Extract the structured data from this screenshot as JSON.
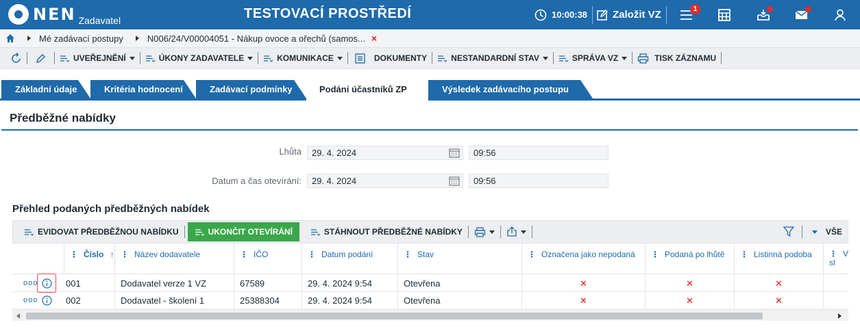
{
  "header": {
    "logo_text": "NEN",
    "logo_sub": "Zadavatel",
    "environment_title": "TESTOVACÍ PROSTŘEDÍ",
    "clock_time": "10:00:38",
    "create_label": "Založit VZ",
    "notifications_count": "1",
    "icons": [
      "clock-icon",
      "edit-icon",
      "menu-icon",
      "calculator-icon",
      "inbox-icon",
      "mail-icon",
      "user-icon"
    ],
    "colors": {
      "primary": "#1e6aab",
      "alert": "#e52b2b"
    }
  },
  "breadcrumb": {
    "items": [
      "Mé zadávací postupy",
      "N006/24/V00004051 - Nákup ovoce a ořechů (samos..."
    ],
    "close_symbol": "×"
  },
  "actionbar": {
    "items": [
      {
        "label": "UVEŘEJNĚNÍ",
        "dropdown": true
      },
      {
        "label": "ÚKONY ZADAVATELE",
        "dropdown": true
      },
      {
        "label": "KOMUNIKACE",
        "dropdown": true
      },
      {
        "label": "DOKUMENTY",
        "dropdown": false
      },
      {
        "label": "NESTANDARDNÍ STAV",
        "dropdown": true
      },
      {
        "label": "SPRÁVA VZ",
        "dropdown": true
      },
      {
        "label": "TISK ZÁZNAMU",
        "dropdown": false
      }
    ]
  },
  "tabs": [
    {
      "label": "Základní údaje",
      "active": false
    },
    {
      "label": "Kritéria hodnocení",
      "active": false
    },
    {
      "label": "Zadávací podmínky",
      "active": false
    },
    {
      "label": "Podání účastníků ZP",
      "active": true
    },
    {
      "label": "Výsledek zadávacího postupu",
      "active": false
    }
  ],
  "section": {
    "title": "Předběžné nabídky",
    "lhuta_label": "Lhůta",
    "lhuta_date": "29. 4. 2024",
    "lhuta_time": "09:56",
    "otevirani_label": "Datum a čas otevírání:",
    "otevirani_date": "29. 4. 2024",
    "otevirani_time": "09:56"
  },
  "grid": {
    "title": "Přehled podaných předběžných nabídek",
    "toolbar": {
      "evidovat": "EVIDOVAT PŘEDBĚŽNOU NABÍDKU",
      "ukoncit": "UKONČIT OTEVÍRÁNÍ",
      "stahnout": "STÁHNOUT PŘEDBĚŽNÉ NABÍDKY",
      "all_label": "VŠE",
      "accent": "#3aa74a"
    },
    "columns": [
      {
        "label": "Číslo",
        "sort": "↑"
      },
      {
        "label": "Název dodavatele"
      },
      {
        "label": "IČO"
      },
      {
        "label": "Datum podání"
      },
      {
        "label": "Stav"
      },
      {
        "label": "Označena jako nepodaná"
      },
      {
        "label": "Podaná po lhůtě"
      },
      {
        "label": "Listinná podoba"
      },
      {
        "label": "Vy sl"
      }
    ],
    "row_actions_symbol": "ooo",
    "cross_symbol": "✕",
    "rows": [
      {
        "cislo": "001",
        "nazev": "Dodavatel verze 1 VZ",
        "ico": "67589",
        "datum": "29. 4. 2024 9:54",
        "stav": "Otevřena",
        "nepodana": "✕",
        "po_lhute": "✕",
        "listinna": "✕"
      },
      {
        "cislo": "002",
        "nazev": "Dodavatel - školení 1",
        "ico": "25388304",
        "datum": "29. 4. 2024 9:54",
        "stav": "Otevřena",
        "nepodana": "✕",
        "po_lhute": "✕",
        "listinna": "✕"
      }
    ]
  }
}
